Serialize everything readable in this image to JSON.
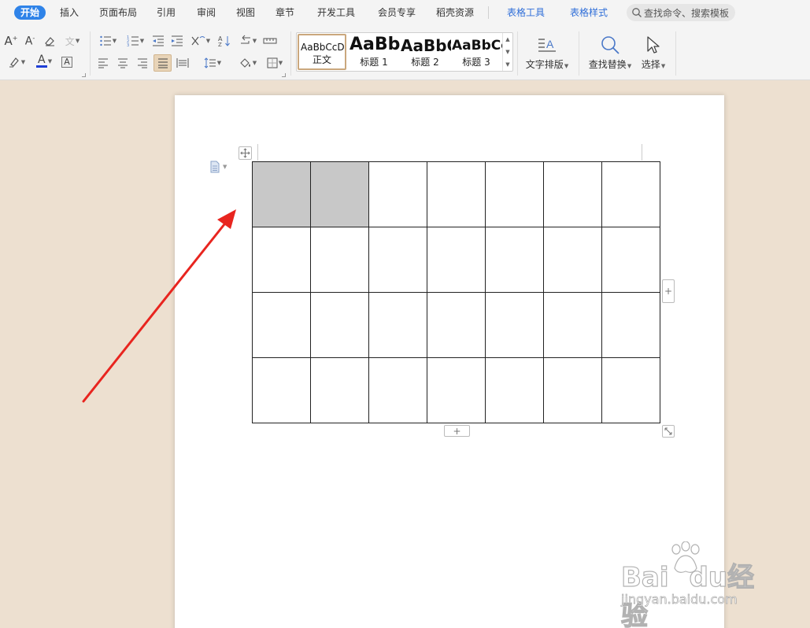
{
  "menu": {
    "tabs": [
      {
        "label": "开始",
        "active": true
      },
      {
        "label": "插入"
      },
      {
        "label": "页面布局"
      },
      {
        "label": "引用"
      },
      {
        "label": "审阅"
      },
      {
        "label": "视图"
      },
      {
        "label": "章节"
      },
      {
        "label": "开发工具"
      },
      {
        "label": "会员专享"
      },
      {
        "label": "稻壳资源"
      }
    ],
    "context_tabs": [
      {
        "label": "表格工具"
      },
      {
        "label": "表格样式"
      }
    ],
    "search_placeholder": "查找命令、搜索模板"
  },
  "ribbon": {
    "styles": [
      {
        "sample": "AaBbCcDd",
        "name": "正文",
        "selected": true
      },
      {
        "sample": "AaBb",
        "name": "标题 1"
      },
      {
        "sample": "AaBbC",
        "name": "标题 2"
      },
      {
        "sample": "AaBbCc",
        "name": "标题 3"
      }
    ],
    "text_layout_label": "文字排版",
    "find_replace_label": "查找替换",
    "select_label": "选择",
    "font_color": "#1f3fd6"
  },
  "document": {
    "table": {
      "rows": 4,
      "cols": 7,
      "selected_cells": [
        [
          0,
          0
        ],
        [
          0,
          1
        ]
      ],
      "selected_color": "#c8c8c8"
    }
  },
  "annotation": {
    "arrow_color": "#e8251f"
  },
  "watermark": {
    "brand": "Bai",
    "brand_suffix": "du",
    "brand_cn": "经验",
    "url": "jingyan.baidu.com"
  }
}
